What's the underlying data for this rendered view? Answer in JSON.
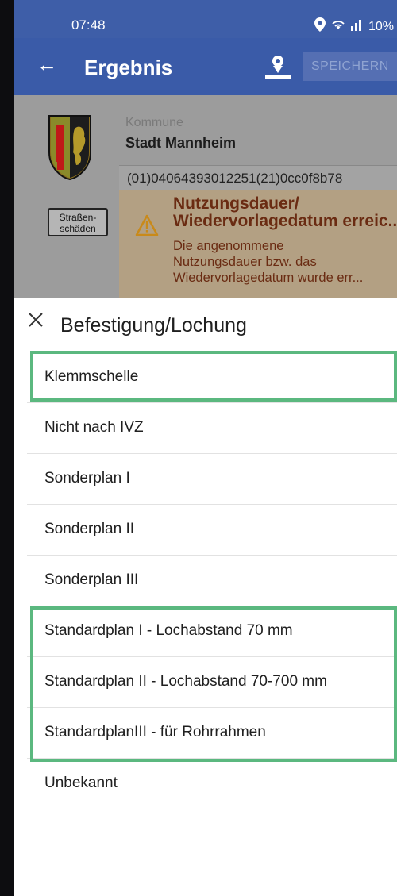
{
  "status": {
    "time": "07:48",
    "battery": "10%"
  },
  "appbar": {
    "back_icon": "arrow-left-icon",
    "title": "Ergebnis",
    "map_icon": "map-marker-icon",
    "save_label": "SPEICHERN"
  },
  "result": {
    "kommune_label": "Kommune",
    "kommune_value": "Stadt Mannheim",
    "code": "(01)04064393012251(21)0cc0f8b78",
    "sign_line1": "Straßen-",
    "sign_line2": "schäden",
    "warning_title_line1": "Nutzungsdauer/",
    "warning_title_line2": "Wiedervorlagedatum erreic...",
    "warning_text_line1": "Die angenommene",
    "warning_text_line2": "Nutzungsdauer bzw. das",
    "warning_text_line3": "Wiedervorlagedatum wurde err..."
  },
  "sheet": {
    "title": "Befestigung/Lochung",
    "items": [
      "Klemmschelle",
      "Nicht nach IVZ",
      "Sonderplan I",
      "Sonderplan II",
      "Sonderplan III",
      "Standardplan I - Lochabstand 70 mm",
      "Standardplan II - Lochabstand 70-700 mm",
      "StandardplanIII - für Rohrrahmen",
      "Unbekannt"
    ]
  },
  "colors": {
    "primary": "#3a5ba8",
    "highlight": "#5bb87f",
    "warning_text": "#6a2b12",
    "warning_bg": "#b3a083"
  }
}
